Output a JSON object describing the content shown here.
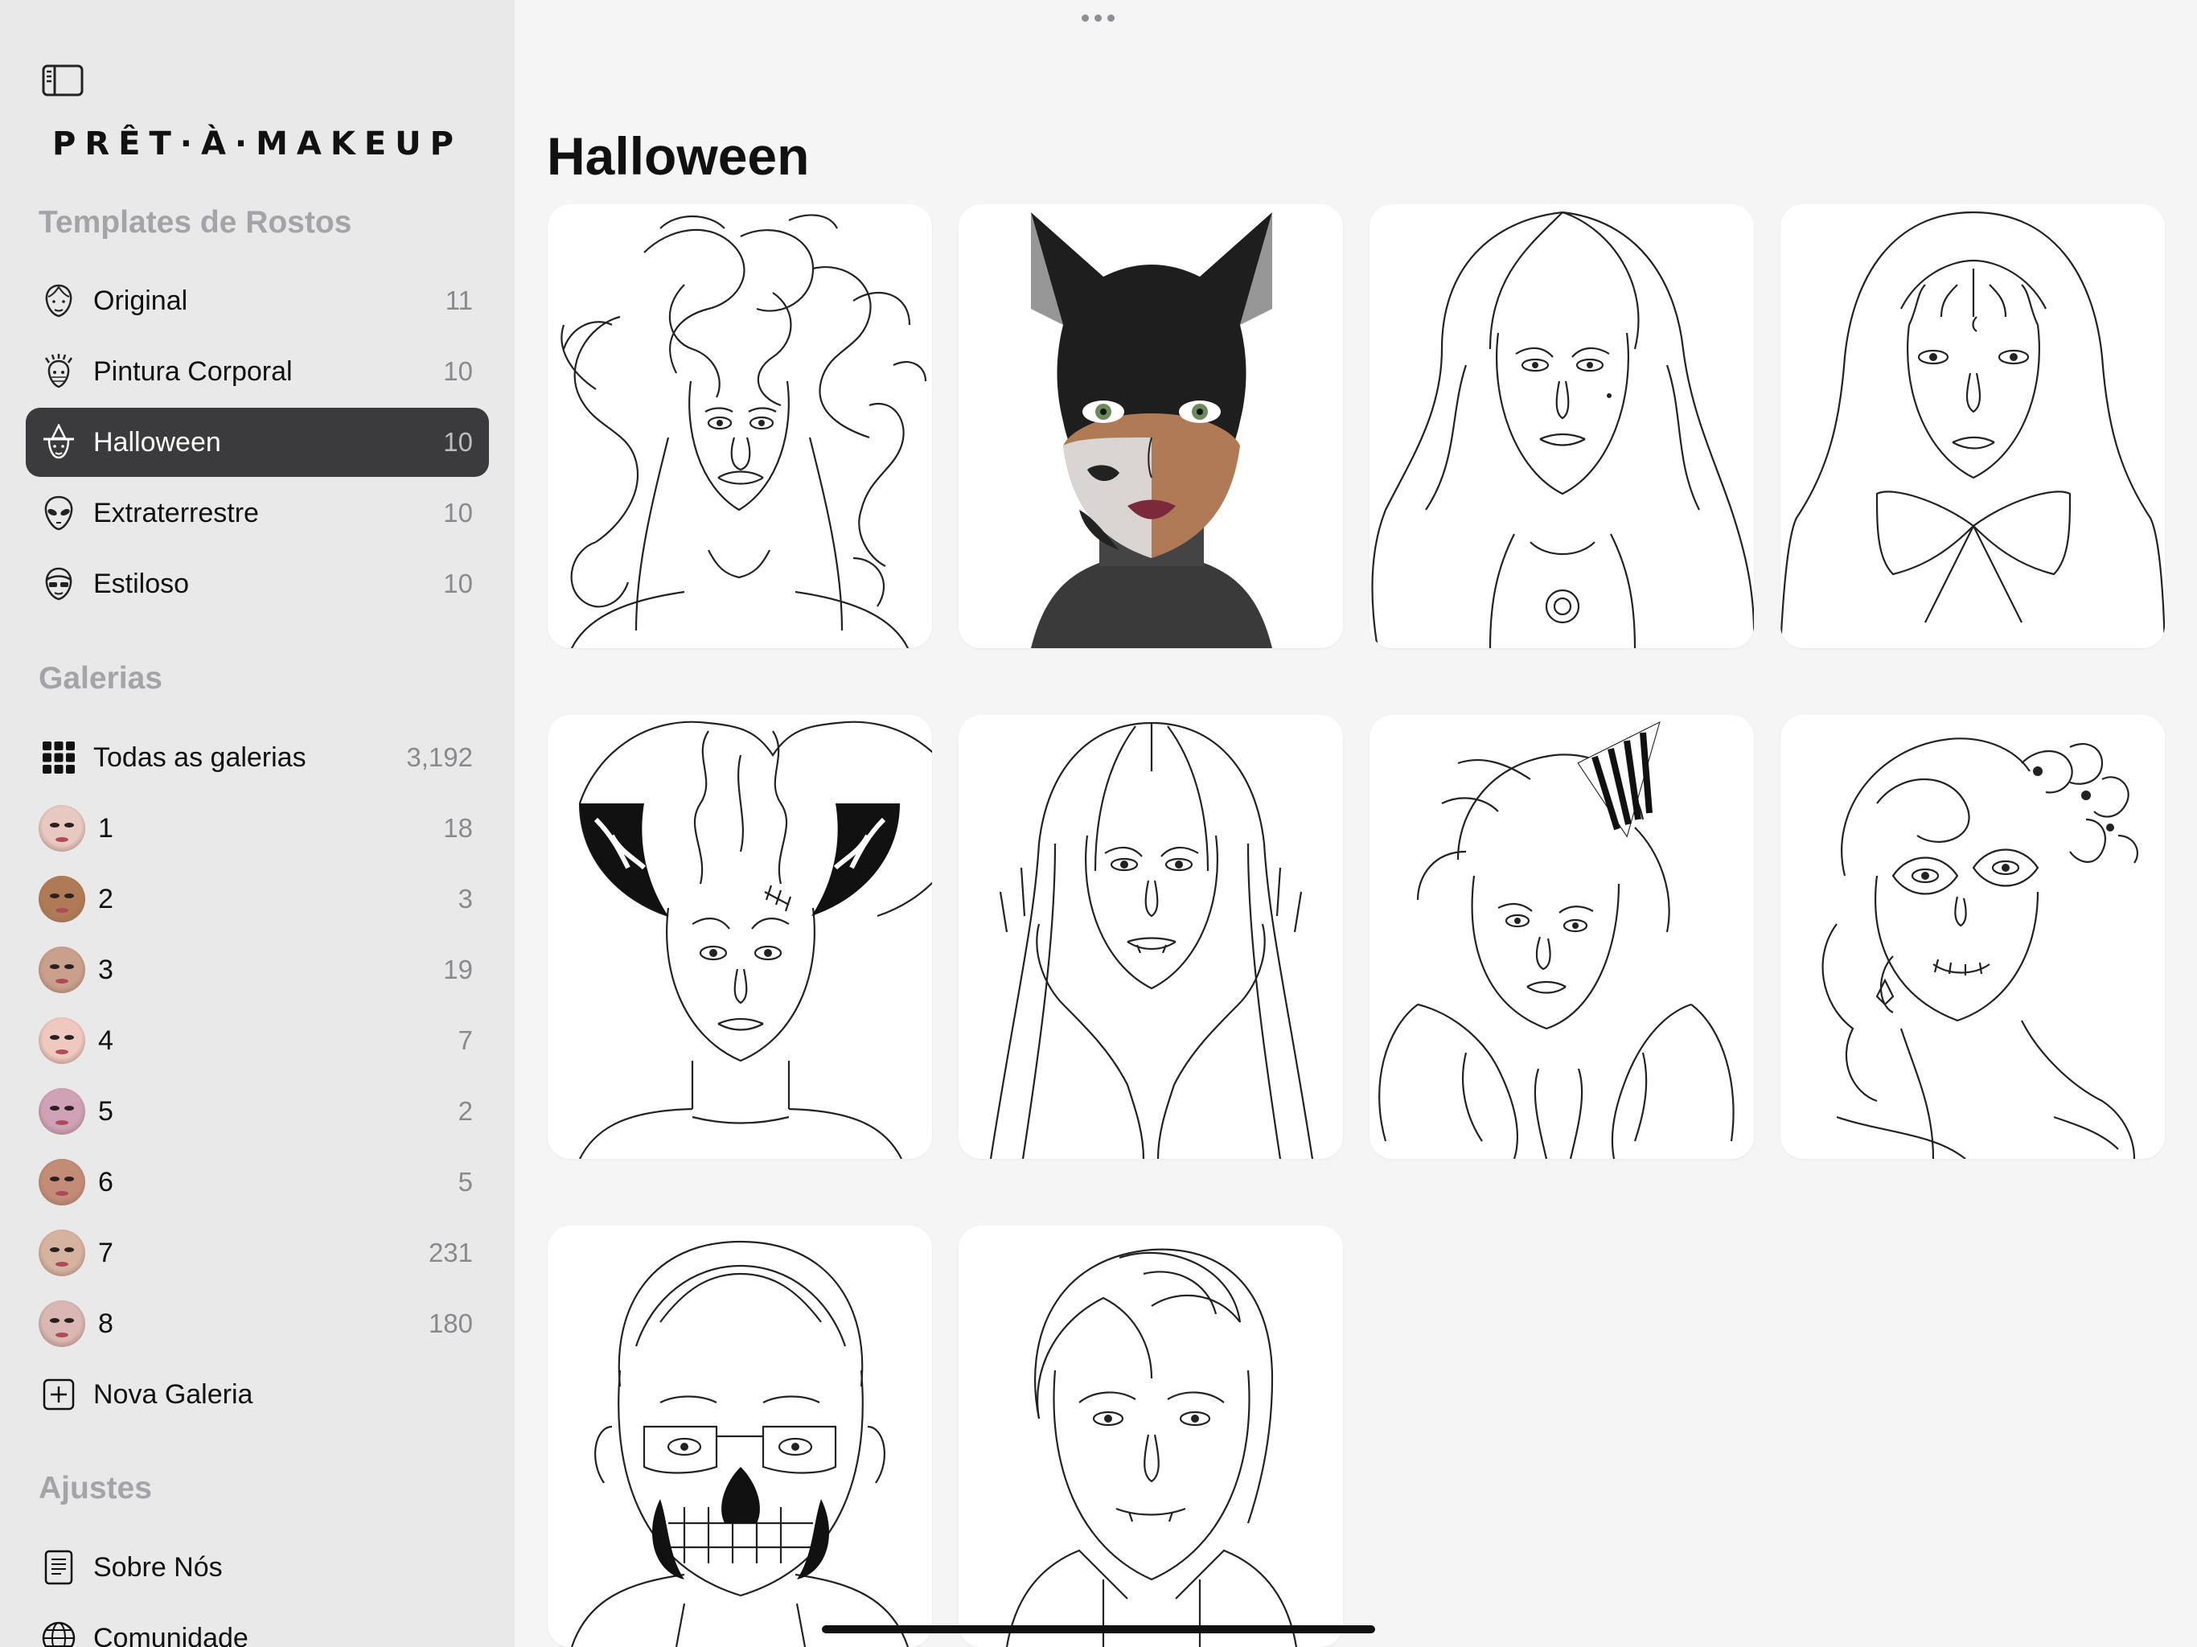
{
  "app": {
    "logo": "PRÊT·À·MAKEUP"
  },
  "sidebar": {
    "templates": {
      "title": "Templates de Rostos",
      "items": [
        {
          "label": "Original",
          "count": "11",
          "icon": "face-outline-icon"
        },
        {
          "label": "Pintura Corporal",
          "count": "10",
          "icon": "body-paint-icon"
        },
        {
          "label": "Halloween",
          "count": "10",
          "icon": "witch-icon",
          "selected": true
        },
        {
          "label": "Extraterrestre",
          "count": "10",
          "icon": "alien-icon"
        },
        {
          "label": "Estiloso",
          "count": "10",
          "icon": "stylish-face-icon"
        }
      ]
    },
    "galleries": {
      "title": "Galerias",
      "all": {
        "label": "Todas as galerias",
        "count": "3,192",
        "icon": "grid-icon"
      },
      "items": [
        {
          "label": "1",
          "count": "18",
          "skin": "#e8c9c1"
        },
        {
          "label": "2",
          "count": "3",
          "skin": "#b07a55"
        },
        {
          "label": "3",
          "count": "19",
          "skin": "#c9a08c"
        },
        {
          "label": "4",
          "count": "7",
          "skin": "#efc8c0"
        },
        {
          "label": "5",
          "count": "2",
          "skin": "#cfa2b7"
        },
        {
          "label": "6",
          "count": "5",
          "skin": "#c28c76"
        },
        {
          "label": "7",
          "count": "231",
          "skin": "#d5b39f"
        },
        {
          "label": "8",
          "count": "180",
          "skin": "#d9b7b3"
        }
      ],
      "new_gallery": {
        "label": "Nova Galeria",
        "icon": "plus-square-icon"
      }
    },
    "settings": {
      "title": "Ajustes",
      "items": [
        {
          "label": "Sobre Nós",
          "icon": "document-icon"
        },
        {
          "label": "Comunidade",
          "icon": "globe-icon"
        }
      ]
    }
  },
  "main": {
    "title": "Halloween",
    "templates": [
      {
        "name": "medusa-template"
      },
      {
        "name": "catwoman-skull-template"
      },
      {
        "name": "long-hair-woman-template"
      },
      {
        "name": "hooded-bow-template"
      },
      {
        "name": "bride-of-frankenstein-template"
      },
      {
        "name": "long-claw-vampire-template"
      },
      {
        "name": "party-hat-clown-template"
      },
      {
        "name": "sugar-skull-flowers-template"
      },
      {
        "name": "skull-glasses-man-template"
      },
      {
        "name": "vampire-man-template"
      }
    ]
  },
  "colors": {
    "selected_row": "#3b3b3d",
    "sidebar_bg": "#e9e9ea",
    "section_title": "#a4a4a8"
  }
}
